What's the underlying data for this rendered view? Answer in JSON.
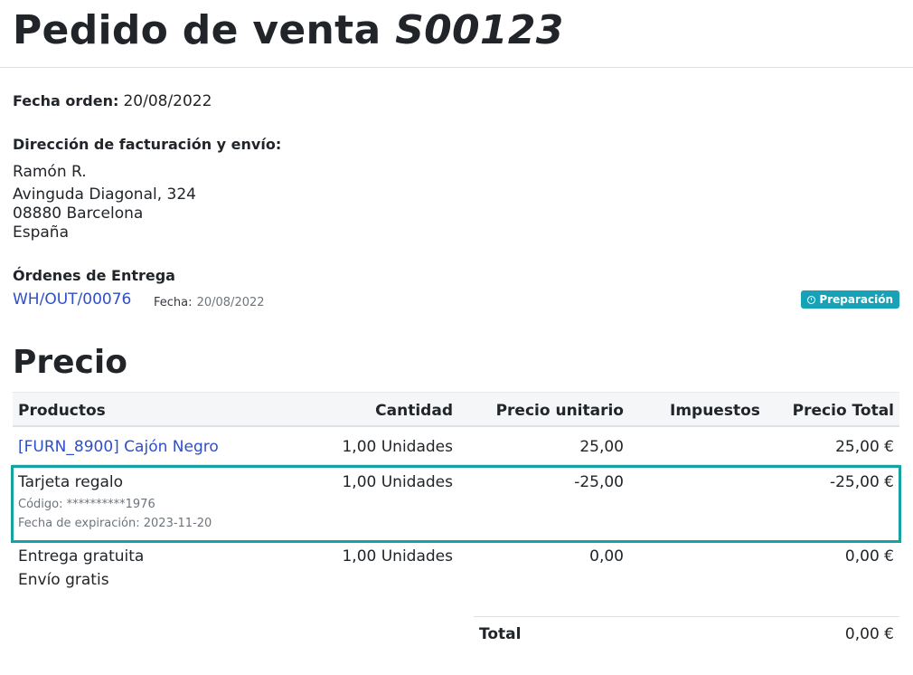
{
  "header": {
    "title_prefix": "Pedido de venta",
    "order_ref": "S00123"
  },
  "order_info": {
    "date_label": "Fecha orden:",
    "date_value": "20/08/2022",
    "address_label": "Dirección de facturación y envío:",
    "address_lines": [
      "Ramón R.",
      "Avinguda Diagonal, 324",
      "08880 Barcelona",
      "España"
    ]
  },
  "deliveries": {
    "label": "Órdenes de Entrega",
    "items": [
      {
        "ref": "WH/OUT/00076",
        "date_label": "Fecha:",
        "date_value": "20/08/2022",
        "status": "Preparación",
        "status_icon": "clock-icon",
        "status_color": "#17a2b8"
      }
    ]
  },
  "price_section": {
    "title": "Precio",
    "columns": [
      "Productos",
      "Cantidad",
      "Precio unitario",
      "Impuestos",
      "Precio Total"
    ],
    "rows": [
      {
        "product": "[FURN_8900] Cajón Negro",
        "is_link": true,
        "qty": "1,00 Unidades",
        "unit_price": "25,00",
        "taxes": "",
        "total": "25,00 €"
      },
      {
        "product": "Tarjeta regalo",
        "code_label": "Código:",
        "code_value": "**********1976",
        "expiry_label": "Fecha de expiración:",
        "expiry_value": "2023-11-20",
        "qty": "1,00 Unidades",
        "unit_price": "-25,00",
        "taxes": "",
        "total": "-25,00 €",
        "highlighted": true,
        "highlight_color": "#17a2a2"
      },
      {
        "product": "Entrega gratuita",
        "product_line2": "Envío gratis",
        "qty": "1,00 Unidades",
        "unit_price": "0,00",
        "taxes": "",
        "total": "0,00 €"
      }
    ],
    "total_label": "Total",
    "total_value": "0,00 €"
  },
  "colors": {
    "link": "#2e4fc9",
    "badge": "#17a2b8",
    "highlight": "#17a2a2"
  }
}
